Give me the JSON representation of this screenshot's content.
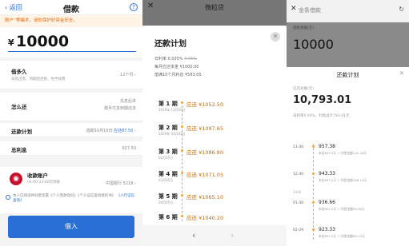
{
  "p1": {
    "back": "返回",
    "title": "借款",
    "help": "?",
    "warning": "账户“等骗术，请你保护好资金安全。",
    "yen": "¥",
    "amount": "10000",
    "term": {
      "label": "借多久",
      "sub": "日息出借，到期后还款，免手续费",
      "value": "12个月"
    },
    "repay": {
      "label": "怎么还",
      "value1": "先息后本",
      "value2": "按月付息到期还本"
    },
    "plan": {
      "label": "还款计划",
      "value": "首期10月10日",
      "value_blue": "应还87.50"
    },
    "interest": {
      "label": "总利息",
      "value": "927.50"
    },
    "account": {
      "label": "收款账户",
      "sub": "04:00-23:00可到账",
      "bank": "中国银行 5218"
    },
    "agree": "本人已阅读并同意签署《个人借款合同》《个人征信查询授权书》",
    "agree2": "《人行征信查询》",
    "button": "借入"
  },
  "p2": {
    "title": "微粒贷",
    "close": "✕",
    "sheet_title": "还款计划",
    "rate": "日利率 0.035%",
    "rate_strike": "0.05%",
    "principal": "每月应还本金 ¥1000.00",
    "total": "借满10个月利息 ¥583.05",
    "items": [
      {
        "term": "第 1 期",
        "date": "2019年\n12月05日",
        "pay": "应还 ¥1052.50"
      },
      {
        "term": "第 2 期",
        "date": "2020年\n01月05日",
        "pay": "应还 ¥1097.65"
      },
      {
        "term": "第 3 期",
        "date": "02月05日",
        "pay": "应还 ¥1086.80"
      },
      {
        "term": "第 4 期",
        "date": "03月05日",
        "pay": "应还 ¥1071.05"
      },
      {
        "term": "第 5 期",
        "date": "04月05日",
        "pay": "应还 ¥1065.10"
      },
      {
        "term": "第 6 期",
        "date": "",
        "pay": "应还 ¥1040.20"
      }
    ],
    "prev": "‹",
    "next": "›"
  },
  "p3": {
    "title": "金条借款",
    "refresh": "↻",
    "close": "✕",
    "dim_label": "借款金额(元)",
    "dim_amount": "10000",
    "sheet_title": "还款计划",
    "total_label": "应还总额(元)",
    "total": "10,793.01",
    "rate_info": "日利率0.04%，利息总计793.01元",
    "items": [
      {
        "date": "11-30",
        "amount": "957.38",
        "sub": "本金837.2元 + 利息金额120.18元"
      },
      {
        "date": "12-30",
        "amount": "943.33",
        "sub": "本金837.2元 + 利息金额106.13元"
      },
      {
        "date": "01-30",
        "amount": "936.66",
        "sub": "本金837.2元 + 利息金额99.46元"
      },
      {
        "date": "02-29",
        "amount": "923.33",
        "sub": "本金837.2元 + 利息金额86.13元"
      }
    ],
    "year": "2020"
  },
  "colors": {
    "blue": "#2a6fd6",
    "orange": "#e46a12",
    "gold": "#f3a63a"
  }
}
